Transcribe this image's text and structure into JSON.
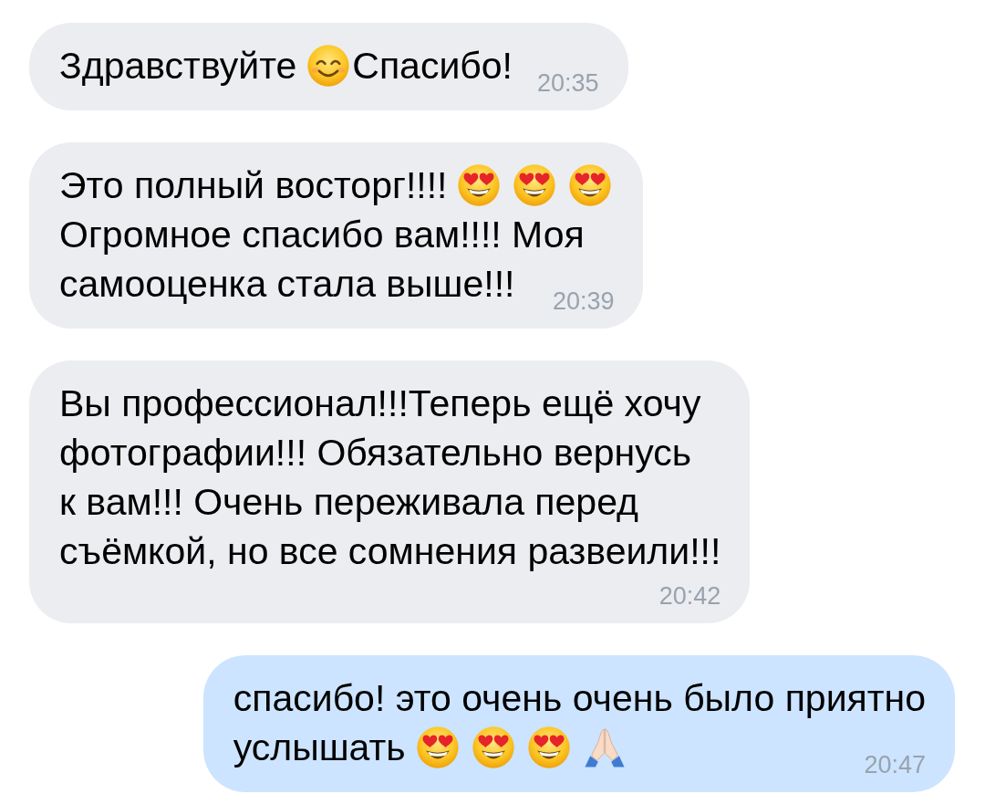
{
  "messages": [
    {
      "kind": "incoming",
      "lines": [
        {
          "parts": [
            {
              "kind": "text",
              "text": "Здравствуйте"
            },
            {
              "kind": "smile"
            },
            {
              "kind": "text",
              "text": "Спасибо!"
            }
          ]
        }
      ],
      "time": "20:35"
    },
    {
      "kind": "incoming",
      "lines": [
        {
          "parts": [
            {
              "kind": "text",
              "text": "Это полный восторг!!!!"
            },
            {
              "kind": "heart_eyes"
            },
            {
              "kind": "heart_eyes"
            },
            {
              "kind": "heart_eyes"
            }
          ]
        },
        {
          "parts": [
            {
              "kind": "text",
              "text": "Огромное спасибо вам!!!! Моя"
            }
          ]
        },
        {
          "parts": [
            {
              "kind": "text",
              "text": "самооценка стала выше!!!"
            }
          ]
        }
      ],
      "time": "20:39"
    },
    {
      "kind": "incoming",
      "lines": [
        {
          "parts": [
            {
              "kind": "text",
              "text": "Вы профессионал!!!Теперь ещё хочу"
            }
          ]
        },
        {
          "parts": [
            {
              "kind": "text",
              "text": "фотографии!!! Обязательно вернусь"
            }
          ]
        },
        {
          "parts": [
            {
              "kind": "text",
              "text": "к вам!!! Очень переживала перед"
            }
          ]
        },
        {
          "parts": [
            {
              "kind": "text",
              "text": "съёмкой, но все сомнения развеили!!!"
            }
          ]
        }
      ],
      "time": "20:42"
    },
    {
      "kind": "outgoing",
      "lines": [
        {
          "parts": [
            {
              "kind": "text",
              "text": "спасибо! это очень очень было приятно"
            }
          ]
        },
        {
          "parts": [
            {
              "kind": "text",
              "text": "услышать"
            },
            {
              "kind": "heart_eyes"
            },
            {
              "kind": "heart_eyes"
            },
            {
              "kind": "heart_eyes"
            },
            {
              "kind": "folded_hands"
            }
          ]
        }
      ],
      "time": "20:47"
    }
  ]
}
